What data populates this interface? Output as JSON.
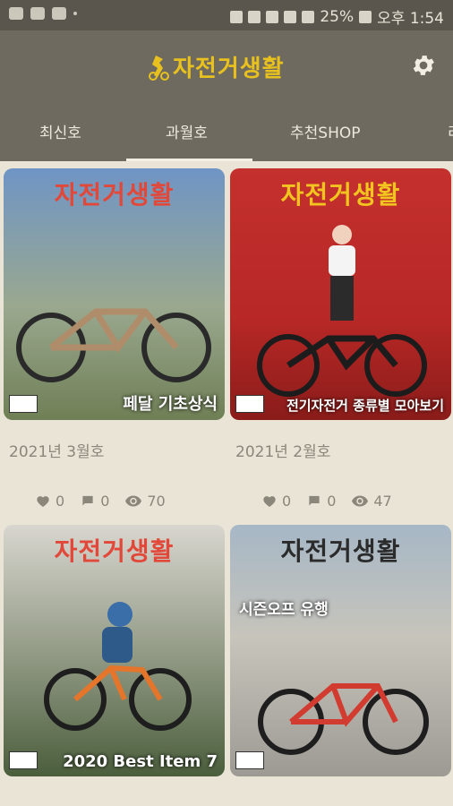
{
  "status": {
    "battery": "25%",
    "time": "오후 1:54"
  },
  "app": {
    "logo_text": "자전거생활"
  },
  "tabs": [
    "최신호",
    "과월호",
    "추천SHOP",
    "리"
  ],
  "issues": [
    {
      "label": "2021년 3월호",
      "cover_title": "자전거생활",
      "cover_headline": "페달 기초상식",
      "likes": "0",
      "comments": "0",
      "views": "70",
      "theme": [
        "#6f95c5",
        "#9aa88f",
        "#6f7f55"
      ]
    },
    {
      "label": "2021년 2월호",
      "cover_title": "자전거생활",
      "cover_headline": "전기자전거 종류별 모아보기",
      "likes": "0",
      "comments": "0",
      "views": "47",
      "theme": [
        "#c4302d",
        "#b72826",
        "#8a1c1a"
      ]
    },
    {
      "label": "",
      "cover_title": "자전거생활",
      "cover_headline": "2020 Best Item 7",
      "likes": "",
      "comments": "",
      "views": "",
      "theme": [
        "#d8d6cf",
        "#8d9680",
        "#4b5e3c"
      ]
    },
    {
      "label": "",
      "cover_title": "자전거생활",
      "cover_headline": "시즌오프 유행",
      "likes": "",
      "comments": "",
      "views": "",
      "theme": [
        "#a6b7c6",
        "#c7c4bb",
        "#9c9a93"
      ]
    }
  ]
}
